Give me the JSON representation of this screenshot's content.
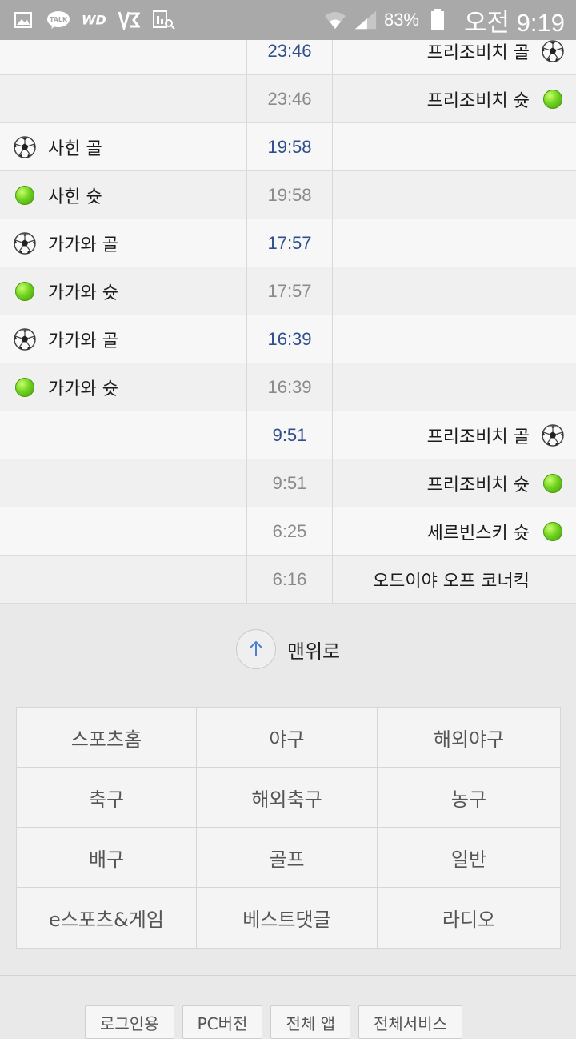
{
  "status_bar": {
    "icons": [
      "gallery-icon",
      "kakaotalk-icon",
      "wd-icon",
      "v3-icon",
      "chart-search-icon"
    ],
    "battery": "83%",
    "clock": "오전 9:19"
  },
  "timeline": [
    {
      "home": {
        "text": "",
        "icon": ""
      },
      "time": "23:46",
      "goal": true,
      "away": {
        "text": "프리조비치 골",
        "icon": "soccer-ball-icon"
      }
    },
    {
      "home": {
        "text": "",
        "icon": ""
      },
      "time": "23:46",
      "goal": false,
      "away": {
        "text": "프리조비치 슛",
        "icon": "shot-dot-icon"
      }
    },
    {
      "home": {
        "text": "사힌 골",
        "icon": "soccer-ball-icon"
      },
      "time": "19:58",
      "goal": true,
      "away": {
        "text": "",
        "icon": ""
      }
    },
    {
      "home": {
        "text": "사힌 슛",
        "icon": "shot-dot-icon"
      },
      "time": "19:58",
      "goal": false,
      "away": {
        "text": "",
        "icon": ""
      }
    },
    {
      "home": {
        "text": "가가와 골",
        "icon": "soccer-ball-icon"
      },
      "time": "17:57",
      "goal": true,
      "away": {
        "text": "",
        "icon": ""
      }
    },
    {
      "home": {
        "text": "가가와 슛",
        "icon": "shot-dot-icon"
      },
      "time": "17:57",
      "goal": false,
      "away": {
        "text": "",
        "icon": ""
      }
    },
    {
      "home": {
        "text": "가가와 골",
        "icon": "soccer-ball-icon"
      },
      "time": "16:39",
      "goal": true,
      "away": {
        "text": "",
        "icon": ""
      }
    },
    {
      "home": {
        "text": "가가와 슛",
        "icon": "shot-dot-icon"
      },
      "time": "16:39",
      "goal": false,
      "away": {
        "text": "",
        "icon": ""
      }
    },
    {
      "home": {
        "text": "",
        "icon": ""
      },
      "time": "9:51",
      "goal": true,
      "away": {
        "text": "프리조비치 골",
        "icon": "soccer-ball-icon"
      }
    },
    {
      "home": {
        "text": "",
        "icon": ""
      },
      "time": "9:51",
      "goal": false,
      "away": {
        "text": "프리조비치 슛",
        "icon": "shot-dot-icon"
      }
    },
    {
      "home": {
        "text": "",
        "icon": ""
      },
      "time": "6:25",
      "goal": false,
      "away": {
        "text": "세르빈스키 슛",
        "icon": "shot-dot-icon"
      }
    },
    {
      "home": {
        "text": "",
        "icon": ""
      },
      "time": "6:16",
      "goal": false,
      "away": {
        "text": "오드이야 오프 코너킥",
        "icon": ""
      }
    }
  ],
  "to_top": {
    "label": "맨위로",
    "icon": "arrow-up-icon"
  },
  "categories": [
    "스포츠홈",
    "야구",
    "해외야구",
    "축구",
    "해외축구",
    "농구",
    "배구",
    "골프",
    "일반",
    "e스포츠&게임",
    "베스트댓글",
    "라디오"
  ],
  "footer_buttons": [
    "로그인용",
    "PC버전",
    "전체 앱",
    "전체서비스"
  ],
  "colors": {
    "goal_time": "#2e4f8c",
    "shot_time": "#8a8a8a",
    "shot_dot": "#6fd11e",
    "status_bar": "#a9a9a9"
  }
}
